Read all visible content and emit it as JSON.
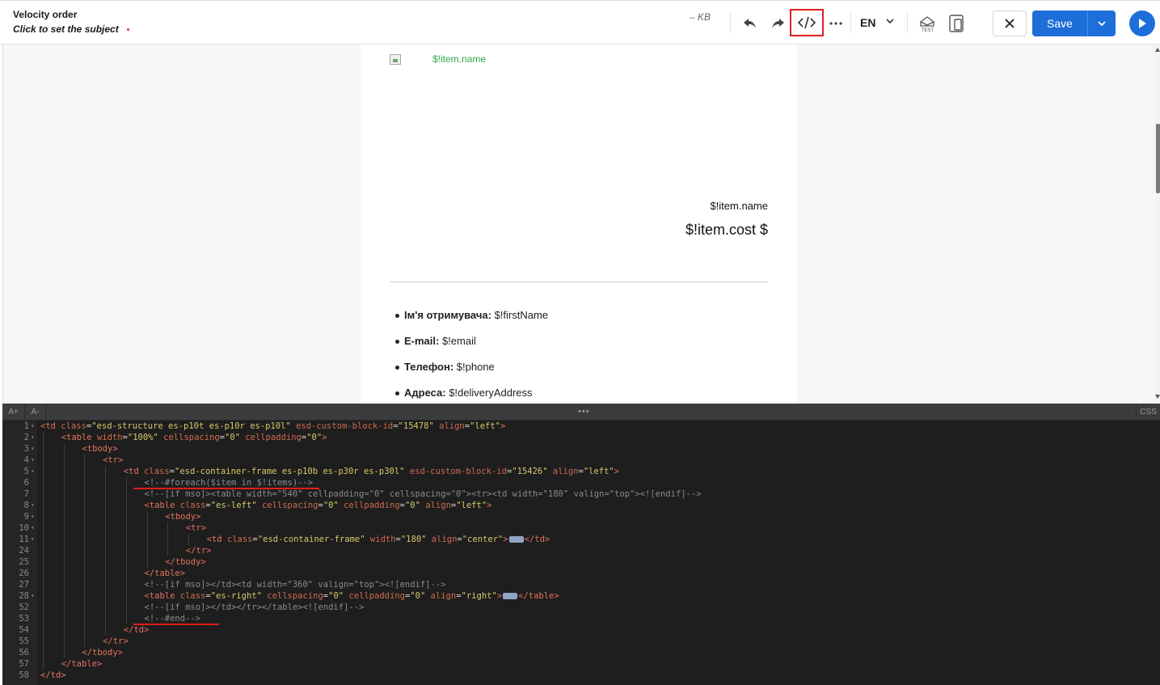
{
  "header": {
    "title": "Velocity order",
    "subtitle": "Click to set the subject",
    "size_label": "– KB",
    "language": "EN",
    "save_label": "Save",
    "icons": {
      "undo": "undo-icon",
      "redo": "redo-icon",
      "code": "code-icon",
      "more": "more-icon",
      "language_dropdown": "chevron-down-icon",
      "test": "test-email-icon",
      "mobile": "mobile-preview-icon",
      "close": "close-icon",
      "save_dropdown": "chevron-down-icon",
      "play": "play-icon"
    },
    "colors": {
      "primary": "#1d6ed8",
      "highlight": "#e02020"
    }
  },
  "preview": {
    "item_link": "$!item.name",
    "item_name": "$!item.name",
    "item_cost": "$!item.cost $",
    "info": [
      {
        "label": "Ім'я отримувача:",
        "value": " $!firstName"
      },
      {
        "label": "E-mail:",
        "value": " $!email"
      },
      {
        "label": "Телефон:",
        "value": " $!phone"
      },
      {
        "label": "Адреса:",
        "value": " $!deliveryAddress"
      }
    ]
  },
  "editor": {
    "font_increase": "A+",
    "font_decrease": "A-",
    "menu_dots": "•••",
    "css_toggle": "CSS",
    "lines": [
      {
        "n": "1",
        "fold": true,
        "indent": 0,
        "tokens": [
          [
            "tag",
            "<td "
          ],
          [
            "attr",
            "class"
          ],
          [
            "eq",
            "="
          ],
          [
            "str",
            "\"esd-structure es-p10t es-p10r es-p10l\""
          ],
          [
            "tag",
            " "
          ],
          [
            "attr",
            "esd-custom-block-id"
          ],
          [
            "eq",
            "="
          ],
          [
            "str",
            "\"15478\""
          ],
          [
            "tag",
            " "
          ],
          [
            "attr",
            "align"
          ],
          [
            "eq",
            "="
          ],
          [
            "str",
            "\"left\""
          ],
          [
            "tag",
            ">"
          ]
        ]
      },
      {
        "n": "2",
        "fold": true,
        "indent": 1,
        "tokens": [
          [
            "tag",
            "<table "
          ],
          [
            "attr",
            "width"
          ],
          [
            "eq",
            "="
          ],
          [
            "str",
            "\"100%\""
          ],
          [
            "tag",
            " "
          ],
          [
            "attr",
            "cellspacing"
          ],
          [
            "eq",
            "="
          ],
          [
            "str",
            "\"0\""
          ],
          [
            "tag",
            " "
          ],
          [
            "attr",
            "cellpadding"
          ],
          [
            "eq",
            "="
          ],
          [
            "str",
            "\"0\""
          ],
          [
            "tag",
            ">"
          ]
        ]
      },
      {
        "n": "3",
        "fold": true,
        "indent": 2,
        "tokens": [
          [
            "tag",
            "<tbody>"
          ]
        ]
      },
      {
        "n": "4",
        "fold": true,
        "indent": 3,
        "tokens": [
          [
            "tag",
            "<tr>"
          ]
        ]
      },
      {
        "n": "5",
        "fold": true,
        "indent": 4,
        "tokens": [
          [
            "tag",
            "<td "
          ],
          [
            "attr",
            "class"
          ],
          [
            "eq",
            "="
          ],
          [
            "str",
            "\"esd-container-frame es-p10b es-p30r es-p30l\""
          ],
          [
            "tag",
            " "
          ],
          [
            "attr",
            "esd-custom-block-id"
          ],
          [
            "eq",
            "="
          ],
          [
            "str",
            "\"15426\""
          ],
          [
            "tag",
            " "
          ],
          [
            "attr",
            "align"
          ],
          [
            "eq",
            "="
          ],
          [
            "str",
            "\"left\""
          ],
          [
            "tag",
            ">"
          ]
        ]
      },
      {
        "n": "6",
        "fold": false,
        "indent": 5,
        "tokens": [
          [
            "com",
            "<!--#foreach($item in $!items)-->"
          ]
        ]
      },
      {
        "n": "7",
        "fold": false,
        "indent": 5,
        "tokens": [
          [
            "com",
            "<!--[if mso]><table width=\"540\" cellpadding=\"0\" cellspacing=\"0\"><tr><td width=\"180\" valign=\"top\"><![endif]-->"
          ]
        ]
      },
      {
        "n": "8",
        "fold": true,
        "indent": 5,
        "tokens": [
          [
            "tag",
            "<table "
          ],
          [
            "attr",
            "class"
          ],
          [
            "eq",
            "="
          ],
          [
            "str",
            "\"es-left\""
          ],
          [
            "tag",
            " "
          ],
          [
            "attr",
            "cellspacing"
          ],
          [
            "eq",
            "="
          ],
          [
            "str",
            "\"0\""
          ],
          [
            "tag",
            " "
          ],
          [
            "attr",
            "cellpadding"
          ],
          [
            "eq",
            "="
          ],
          [
            "str",
            "\"0\""
          ],
          [
            "tag",
            " "
          ],
          [
            "attr",
            "align"
          ],
          [
            "eq",
            "="
          ],
          [
            "str",
            "\"left\""
          ],
          [
            "tag",
            ">"
          ]
        ]
      },
      {
        "n": "9",
        "fold": true,
        "indent": 6,
        "tokens": [
          [
            "tag",
            "<tbody>"
          ]
        ]
      },
      {
        "n": "10",
        "fold": true,
        "indent": 7,
        "tokens": [
          [
            "tag",
            "<tr>"
          ]
        ]
      },
      {
        "n": "11",
        "fold": true,
        "indent": 8,
        "tokens": [
          [
            "tag",
            "<td "
          ],
          [
            "attr",
            "class"
          ],
          [
            "eq",
            "="
          ],
          [
            "str",
            "\"esd-container-frame\""
          ],
          [
            "tag",
            " "
          ],
          [
            "attr",
            "width"
          ],
          [
            "eq",
            "="
          ],
          [
            "str",
            "\"180\""
          ],
          [
            "tag",
            " "
          ],
          [
            "attr",
            "align"
          ],
          [
            "eq",
            "="
          ],
          [
            "str",
            "\"center\""
          ],
          [
            "tag",
            ">"
          ],
          [
            "badge",
            ""
          ],
          [
            "tag",
            "</td>"
          ]
        ]
      },
      {
        "n": "24",
        "fold": false,
        "indent": 7,
        "tokens": [
          [
            "tag",
            "</tr>"
          ]
        ]
      },
      {
        "n": "25",
        "fold": false,
        "indent": 6,
        "tokens": [
          [
            "tag",
            "</tbody>"
          ]
        ]
      },
      {
        "n": "26",
        "fold": false,
        "indent": 5,
        "tokens": [
          [
            "tag",
            "</table>"
          ]
        ]
      },
      {
        "n": "27",
        "fold": false,
        "indent": 5,
        "tokens": [
          [
            "com",
            "<!--[if mso]></td><td width=\"360\" valign=\"top\"><![endif]-->"
          ]
        ]
      },
      {
        "n": "28",
        "fold": true,
        "indent": 5,
        "tokens": [
          [
            "tag",
            "<table "
          ],
          [
            "attr",
            "class"
          ],
          [
            "eq",
            "="
          ],
          [
            "str",
            "\"es-right\""
          ],
          [
            "tag",
            " "
          ],
          [
            "attr",
            "cellspacing"
          ],
          [
            "eq",
            "="
          ],
          [
            "str",
            "\"0\""
          ],
          [
            "tag",
            " "
          ],
          [
            "attr",
            "cellpadding"
          ],
          [
            "eq",
            "="
          ],
          [
            "str",
            "\"0\""
          ],
          [
            "tag",
            " "
          ],
          [
            "attr",
            "align"
          ],
          [
            "eq",
            "="
          ],
          [
            "str",
            "\"right\""
          ],
          [
            "tag",
            ">"
          ],
          [
            "badge",
            ""
          ],
          [
            "tag",
            "</table>"
          ]
        ]
      },
      {
        "n": "52",
        "fold": false,
        "indent": 5,
        "tokens": [
          [
            "com",
            "<!--[if mso]></td></tr></table><![endif]-->"
          ]
        ]
      },
      {
        "n": "53",
        "fold": false,
        "indent": 5,
        "tokens": [
          [
            "com",
            "<!--#end-->"
          ]
        ]
      },
      {
        "n": "54",
        "fold": false,
        "indent": 4,
        "tokens": [
          [
            "tag",
            "</td>"
          ]
        ]
      },
      {
        "n": "55",
        "fold": false,
        "indent": 3,
        "tokens": [
          [
            "tag",
            "</tr>"
          ]
        ]
      },
      {
        "n": "56",
        "fold": false,
        "indent": 2,
        "tokens": [
          [
            "tag",
            "</tbody>"
          ]
        ]
      },
      {
        "n": "57",
        "fold": false,
        "indent": 1,
        "tokens": [
          [
            "tag",
            "</table>"
          ]
        ]
      },
      {
        "n": "58",
        "fold": false,
        "indent": 0,
        "tokens": [
          [
            "tag",
            "</td>"
          ]
        ]
      }
    ]
  }
}
